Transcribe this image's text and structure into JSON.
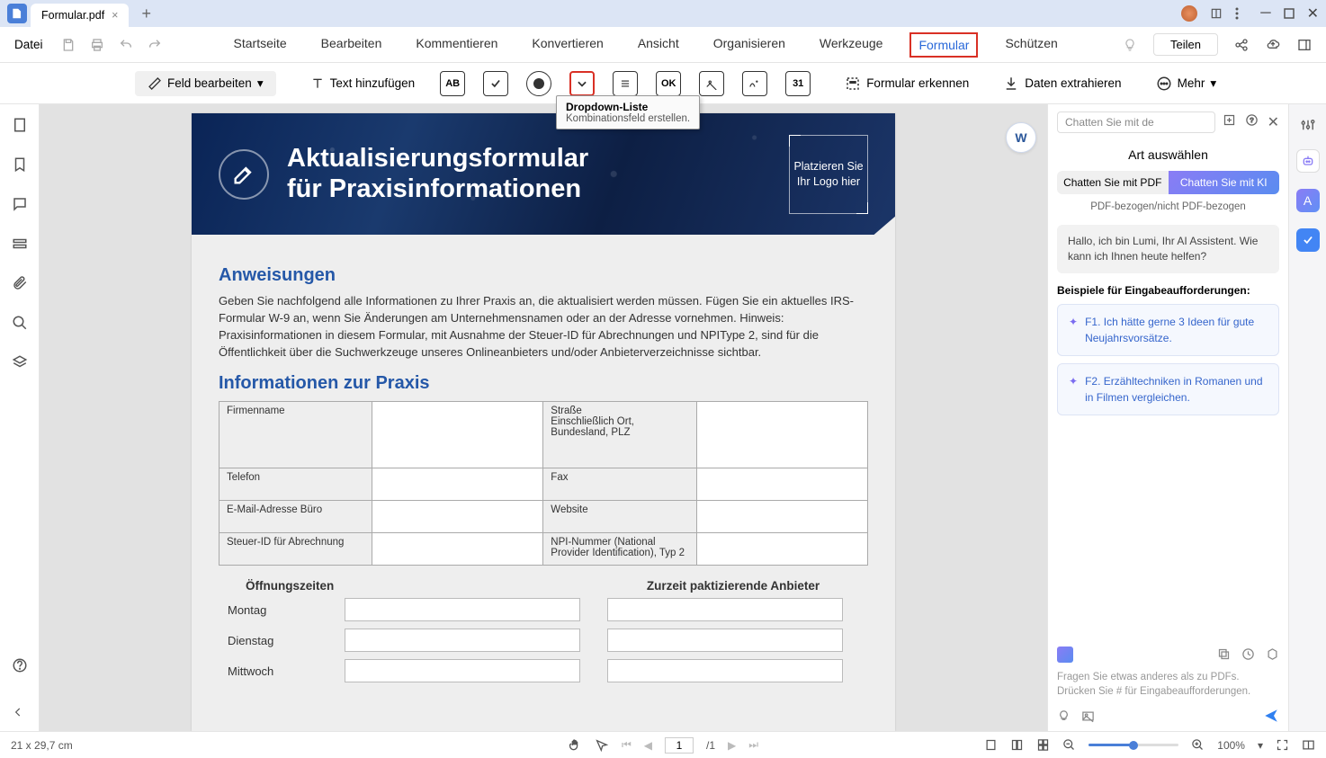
{
  "titlebar": {
    "tab_title": "Formular.pdf"
  },
  "menu": {
    "file": "Datei",
    "tabs": [
      "Startseite",
      "Bearbeiten",
      "Kommentieren",
      "Konvertieren",
      "Ansicht",
      "Organisieren",
      "Werkzeuge",
      "Formular",
      "Schützen"
    ],
    "active_index": 7,
    "share": "Teilen"
  },
  "toolbar": {
    "field_edit": "Feld bearbeiten",
    "text_add": "Text hinzufügen",
    "recognize": "Formular erkennen",
    "extract": "Daten extrahieren",
    "more": "Mehr",
    "icons": {
      "ab": "AB",
      "ok": "OK",
      "num": "31"
    }
  },
  "tooltip": {
    "title": "Dropdown-Liste",
    "desc": "Kombinationsfeld erstellen."
  },
  "doc": {
    "header_title_l1": "Aktualisierungsformular",
    "header_title_l2": "für Praxisinformationen",
    "logo_text": "Platzieren Sie Ihr Logo hier",
    "h_instructions": "Anweisungen",
    "instructions": "Geben Sie nachfolgend alle Informationen zu Ihrer Praxis an, die aktualisiert werden müssen. Fügen Sie ein aktuelles IRS-Formular W-9 an, wenn Sie Änderungen am Unternehmensnamen oder an der Adresse vornehmen. Hinweis: Praxisinformationen in diesem Formular, mit Ausnahme der Steuer-ID für Abrechnungen und NPIType 2, sind für die Öffentlichkeit über die Suchwerkzeuge unseres Onlineanbieters und/oder Anbieterverzeichnisse sichtbar.",
    "h_practice": "Informationen zur Praxis",
    "fields": {
      "company": "Firmenname",
      "street": "Straße",
      "street_sub": "Einschließlich Ort, Bundesland, PLZ",
      "phone": "Telefon",
      "fax": "Fax",
      "email": "E-Mail-Adresse Büro",
      "website": "Website",
      "taxid": "Steuer-ID für Abrechnung",
      "npi": "NPI-Nummer (National Provider Identification), Typ 2"
    },
    "hours_header": "Öffnungszeiten",
    "providers_header": "Zurzeit paktizierende Anbieter",
    "days": {
      "mon": "Montag",
      "tue": "Dienstag",
      "wed": "Mittwoch"
    }
  },
  "chat": {
    "placeholder": "Chatten Sie mit de",
    "section": "Art auswählen",
    "toggle_pdf": "Chatten Sie mit PDF",
    "toggle_ai": "Chatten Sie mit KI",
    "subtitle": "PDF-bezogen/nicht PDF-bezogen",
    "greeting": "Hallo, ich bin Lumi, Ihr AI Assistent. Wie kann ich Ihnen heute helfen?",
    "examples_title": "Beispiele für Eingabeaufforderungen:",
    "ex1": "F1. Ich hätte gerne 3 Ideen für gute Neujahrsvorsätze.",
    "ex2": "F2. Erzähltechniken in Romanen und in Filmen vergleichen.",
    "prompt": "Fragen Sie etwas anderes als zu PDFs. Drücken Sie # für Eingabeaufforderungen."
  },
  "status": {
    "dims": "21 x 29,7 cm",
    "page_cur": "1",
    "page_total": "/1",
    "zoom": "100%"
  }
}
